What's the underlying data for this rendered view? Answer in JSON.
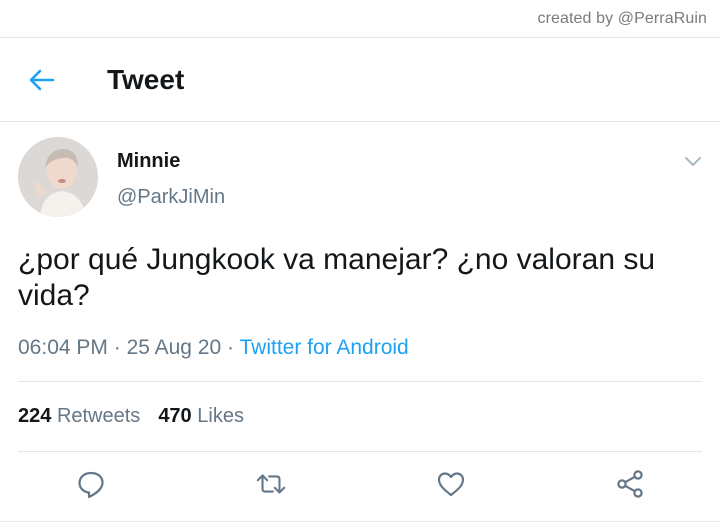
{
  "watermark": "created by @PerraRuin",
  "header": {
    "title": "Tweet",
    "back_icon": "arrow-left-icon"
  },
  "tweet": {
    "author_name": "Minnie",
    "author_handle": "@ParkJiMin",
    "text": "¿por qué Jungkook va manejar? ¿no valoran su vida?",
    "time": "06:04 PM",
    "date": "25 Aug 20",
    "separator": "·",
    "source": "Twitter for Android",
    "retweets_count": "224",
    "retweets_label": "Retweets",
    "likes_count": "470",
    "likes_label": "Likes"
  },
  "actions": [
    {
      "name": "reply",
      "icon": "reply-icon"
    },
    {
      "name": "retweet",
      "icon": "retweet-icon"
    },
    {
      "name": "like",
      "icon": "heart-icon"
    },
    {
      "name": "share",
      "icon": "share-icon"
    }
  ],
  "colors": {
    "accent": "#1da1f2",
    "text_primary": "#14171a",
    "text_secondary": "#657786",
    "divider": "#e1e8ed"
  }
}
